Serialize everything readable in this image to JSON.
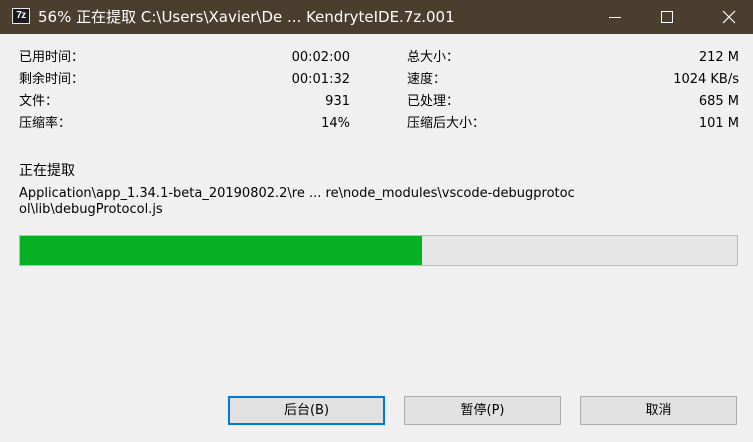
{
  "window": {
    "title": "56% 正在提取 C:\\Users\\Xavier\\De ... KendryteIDE.7z.001",
    "app_icon_text": "7z",
    "controls": {
      "minimize": "minimize-icon",
      "maximize": "maximize-icon",
      "close": "close-icon"
    }
  },
  "stats": {
    "elapsed_label": "已用时间：",
    "elapsed_value": "00:02:00",
    "remaining_label": "剩余时间：",
    "remaining_value": "00:01:32",
    "files_label": "文件：",
    "files_value": "931",
    "ratio_label": "压缩率：",
    "ratio_value": "14%",
    "total_label": "总大小：",
    "total_value": "212 M",
    "speed_label": "速度：",
    "speed_value": "1024 KB/s",
    "processed_label": "已处理：",
    "processed_value": "685 M",
    "compressed_label": "压缩后大小：",
    "compressed_value": "101 M"
  },
  "operation": {
    "title": "正在提取",
    "current_path": "Application\\app_1.34.1-beta_20190802.2\\re ... re\\node_modules\\vscode-debugprotocol\\lib\\debugProtocol.js"
  },
  "progress": {
    "fraction": 0.56,
    "color": "#06b025"
  },
  "buttons": {
    "background": "后台(B)",
    "pause": "暂停(P)",
    "cancel": "取消"
  },
  "colors": {
    "titlebar": "#4a3e2f",
    "default_button_border": "#0078d7"
  }
}
